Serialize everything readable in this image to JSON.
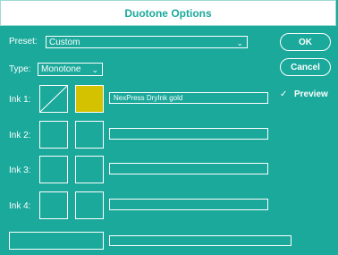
{
  "dialog": {
    "title": "Duotone Options"
  },
  "preset": {
    "label": "Preset:",
    "value": "Custom",
    "chevron": "⌄"
  },
  "type": {
    "label": "Type:",
    "value": "Monotone",
    "chevron": "⌄"
  },
  "buttons": {
    "ok": "OK",
    "cancel": "Cancel"
  },
  "preview": {
    "label": "Preview",
    "checked": true,
    "check_glyph": "✓"
  },
  "inks": [
    {
      "label": "Ink 1:",
      "name": "NexPress DryInk gold",
      "color": "#d4c100"
    },
    {
      "label": "Ink 2:",
      "name": ""
    },
    {
      "label": "Ink 3:",
      "name": ""
    },
    {
      "label": "Ink 4:",
      "name": ""
    }
  ],
  "colors": {
    "background": "#1aa99b",
    "title_text": "#1aa99b",
    "ink1_swatch": "#d4c100"
  }
}
